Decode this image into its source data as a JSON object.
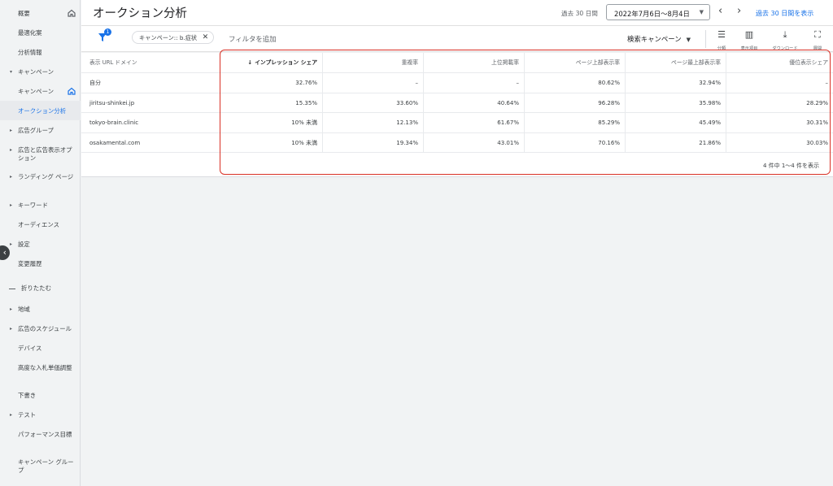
{
  "sidebar": {
    "items": [
      {
        "label": "概要",
        "home": true
      },
      {
        "label": "最適化案"
      },
      {
        "label": "分析情報"
      },
      {
        "label": "キャンペーン",
        "arrow": "▾"
      },
      {
        "label": "キャンペーン",
        "home": true
      },
      {
        "label": "オークション分析",
        "active": true
      },
      {
        "label": "広告グループ",
        "arrow": "▸"
      },
      {
        "label": "広告と広告表示オプション",
        "arrow": "▸"
      },
      {
        "label": "ランディング ページ",
        "arrow": "▸"
      },
      {
        "label": "キーワード",
        "arrow": "▸"
      },
      {
        "label": "オーディエンス"
      },
      {
        "label": "設定",
        "arrow": "▸"
      },
      {
        "label": "変更履歴"
      },
      {
        "label": "折りたたむ"
      },
      {
        "label": "地域",
        "arrow": "▸"
      },
      {
        "label": "広告のスケジュール",
        "arrow": "▸"
      },
      {
        "label": "デバイス"
      },
      {
        "label": "高度な入札単価調整"
      },
      {
        "label": "下書き"
      },
      {
        "label": "テスト",
        "arrow": "▸"
      },
      {
        "label": "パフォーマンス目標"
      },
      {
        "label": "キャンペーン グループ"
      }
    ],
    "toggle_glyph": "‹"
  },
  "header": {
    "title": "オークション分析",
    "date_label": "過去 30 日間",
    "date_range": "2022年7月6日〜8月4日",
    "show_30_link": "過去 30 日間を表示"
  },
  "filterbar": {
    "filter_count": "1",
    "chip_label": "キャンペーン:: b.症状",
    "add_filter": "フィルタを追加",
    "campaign_select": "検索キャンペーン",
    "tools": [
      {
        "icon": "segment-icon",
        "label": "分類"
      },
      {
        "icon": "columns-icon",
        "label": "表示項目"
      },
      {
        "icon": "download-icon",
        "label": "ダウンロード"
      },
      {
        "icon": "expand-icon",
        "label": "展開"
      }
    ]
  },
  "table": {
    "headers": [
      "表示 URL ドメイン",
      "インプレッション シェア",
      "重複率",
      "上位掲載率",
      "ページ上部表示率",
      "ページ最上部表示率",
      "優位表示シェア"
    ],
    "sorted_prefix": "↓",
    "rows": [
      [
        "自分",
        "32.76%",
        "–",
        "–",
        "80.62%",
        "32.94%",
        "–"
      ],
      [
        "jiritsu-shinkei.jp",
        "15.35%",
        "33.60%",
        "40.64%",
        "96.28%",
        "35.98%",
        "28.29%"
      ],
      [
        "tokyo-brain.clinic",
        "10% 未満",
        "12.13%",
        "61.67%",
        "85.29%",
        "45.49%",
        "30.31%"
      ],
      [
        "osakamental.com",
        "10% 未満",
        "19.34%",
        "43.01%",
        "70.16%",
        "21.86%",
        "30.03%"
      ]
    ],
    "footer": "4 件中 1〜4 件を表示"
  },
  "colors": {
    "accent": "#1a73e8",
    "highlight": "#d93025"
  }
}
